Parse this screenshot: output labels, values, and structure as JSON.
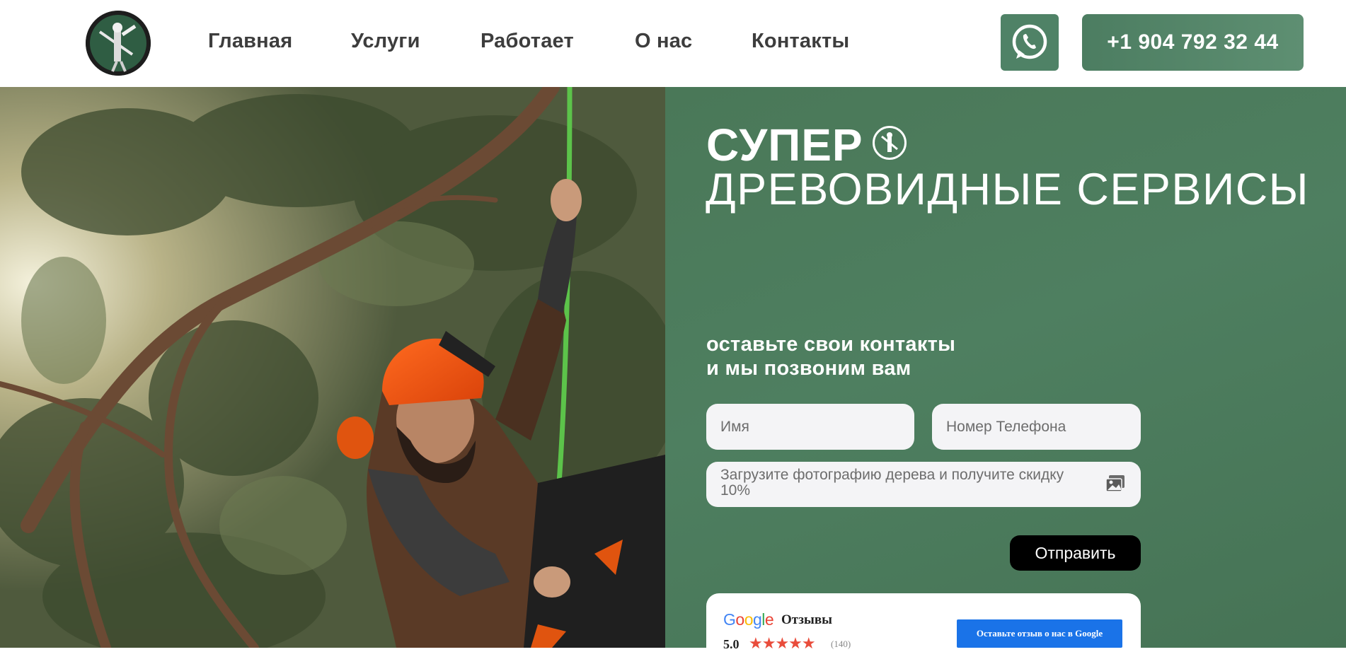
{
  "header": {
    "nav": [
      {
        "label": "Главная"
      },
      {
        "label": "Услуги"
      },
      {
        "label": "Работает"
      },
      {
        "label": "О нас"
      },
      {
        "label": "Контакты"
      }
    ],
    "phone": "+1 904 792 32 44",
    "whatsapp_icon": "whatsapp-icon",
    "logo_icon": "tree-climber-logo"
  },
  "hero": {
    "title_bold": "СУПЕР",
    "title_light": "ДРЕВОВИДНЫЕ СЕРВИСЫ",
    "lead_line1": "оставьте свои контакты",
    "lead_line2": "и мы позвоним вам"
  },
  "form": {
    "name_placeholder": "Имя",
    "phone_placeholder": "Номер Телефона",
    "upload_text": "Загрузите фотографию дерева и получите скидку 10%",
    "upload_icon": "image-icon",
    "submit_label": "Отправить"
  },
  "reviews": {
    "brand": "Google",
    "label": "Отзывы",
    "rating": "5.0",
    "stars": "★★★★★",
    "count": "(140)",
    "button_label": "Оставьте отзыв о нас в Google"
  },
  "colors": {
    "accent_green": "#4f8266",
    "panel_green": "#4a7858",
    "submit_black": "#000000",
    "google_blue": "#1a73e8",
    "star_red": "#e94c3b"
  }
}
